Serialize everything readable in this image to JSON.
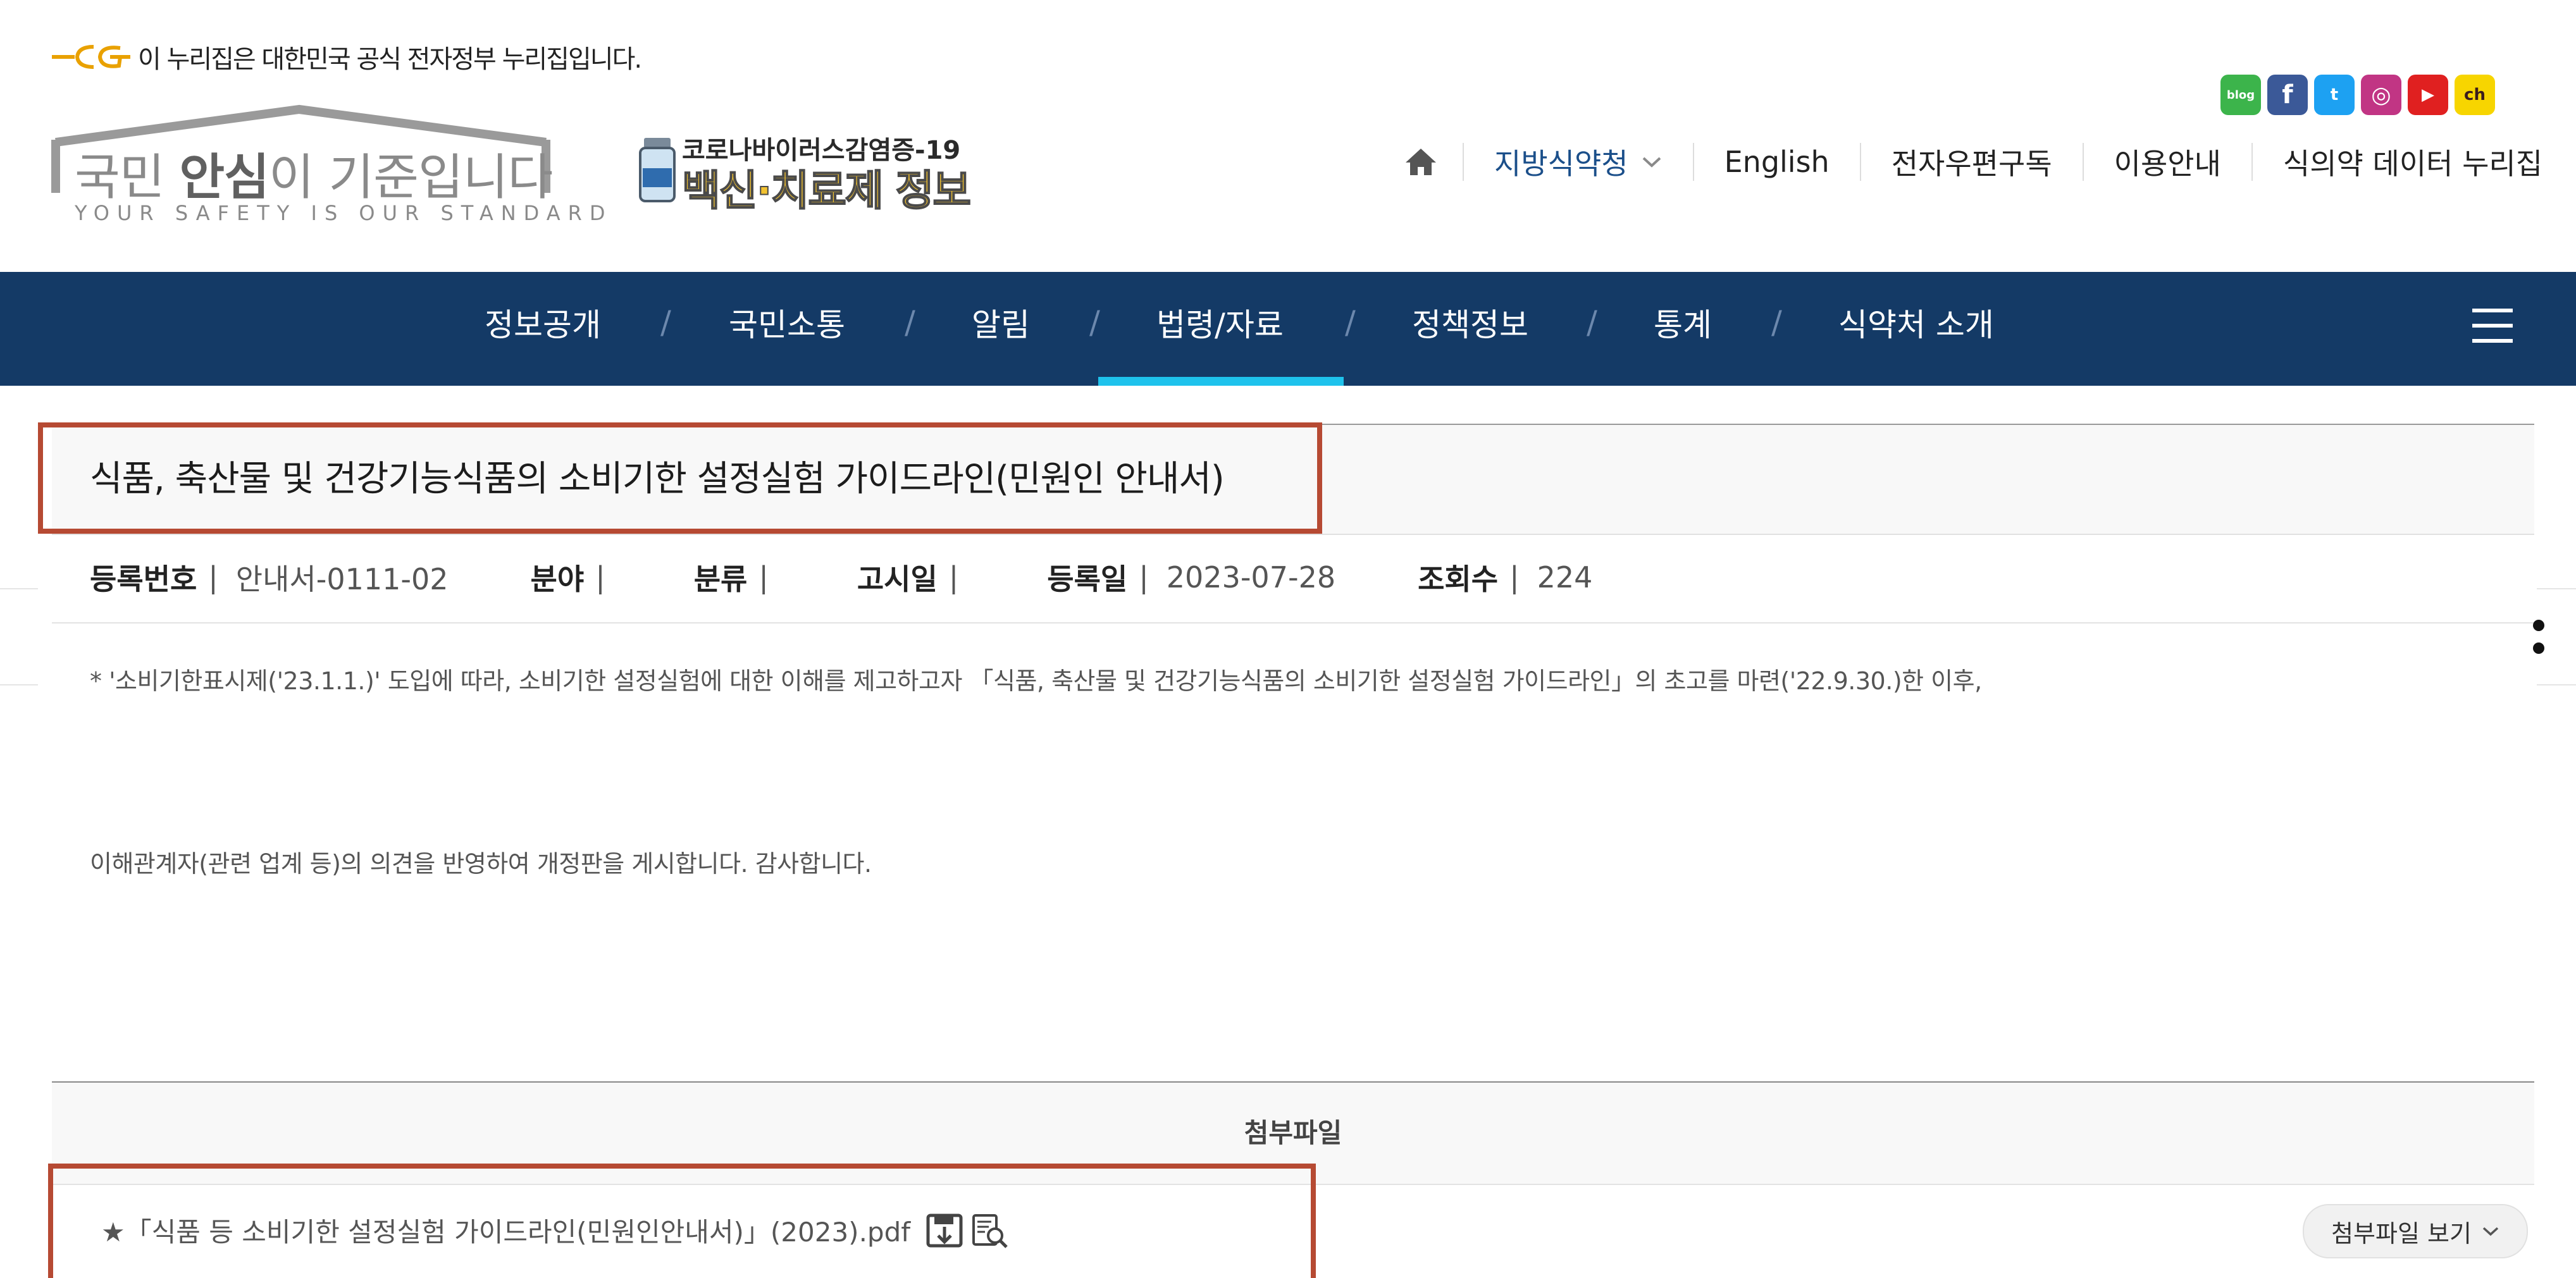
{
  "gov_banner": {
    "text": "이 누리집은 대한민국 공식 전자정부 누리집입니다."
  },
  "logo": {
    "main_1": "국민 ",
    "main_bold": "안심",
    "main_2": "이 기준입니다",
    "sub": "YOUR SAFETY IS OUR STANDARD"
  },
  "covid_banner": {
    "line1": "코로나바이러스감염증-19",
    "line2": "백신·치료제 정보"
  },
  "social": [
    {
      "icon": "blog-icon",
      "label": "blog",
      "color": "#3cb44b"
    },
    {
      "icon": "facebook-icon",
      "label": "f",
      "color": "#3b5998"
    },
    {
      "icon": "twitter-icon",
      "label": "t",
      "color": "#1da1f2"
    },
    {
      "icon": "instagram-icon",
      "label": "◎",
      "color": "#c13584"
    },
    {
      "icon": "youtube-icon",
      "label": "▶",
      "color": "#e02020"
    },
    {
      "icon": "kakao-icon",
      "label": "ch",
      "color": "#f7d500"
    }
  ],
  "util_nav": {
    "home_icon": "home-icon",
    "regional": "지방식약청",
    "english": "English",
    "newsletter": "전자우편구독",
    "guide": "이용안내",
    "data": "식의약 데이터 누리집"
  },
  "main_nav": {
    "items": [
      "정보공개",
      "국민소통",
      "알림",
      "법령/자료",
      "정책정보",
      "통계",
      "식약처 소개"
    ],
    "separator": "/",
    "active_index": 3
  },
  "post": {
    "title": "식품, 축산물 및 건강기능식품의 소비기한 설정실험 가이드라인(민원인 안내서)",
    "meta": {
      "reg_no_label": "등록번호",
      "reg_no_value": "안내서-0111-02",
      "field_label": "분야",
      "category_label": "분류",
      "notice_label": "고시일",
      "reg_date_label": "등록일",
      "reg_date_value": "2023-07-28",
      "views_label": "조회수",
      "views_value": "224",
      "sep": "|"
    },
    "body_line1": "* '소비기한표시제('23.1.1.)' 도입에 따라, 소비기한 설정실험에 대한 이해를 제고하고자 「식품, 축산물 및 건강기능식품의 소비기한 설정실험 가이드라인」의 초고를 마련('22.9.30.)한 이후,",
    "body_line2": "이해관계자(관련 업계 등)의 의견을 반영하여 개정판을 게시합니다. 감사합니다."
  },
  "attachments": {
    "header": "첨부파일",
    "file_name": "★「식품 등 소비기한 설정실험 가이드라인(민원인안내서)」(2023).pdf",
    "view_button": "첨부파일 보기",
    "view_chevron": "⌄"
  }
}
